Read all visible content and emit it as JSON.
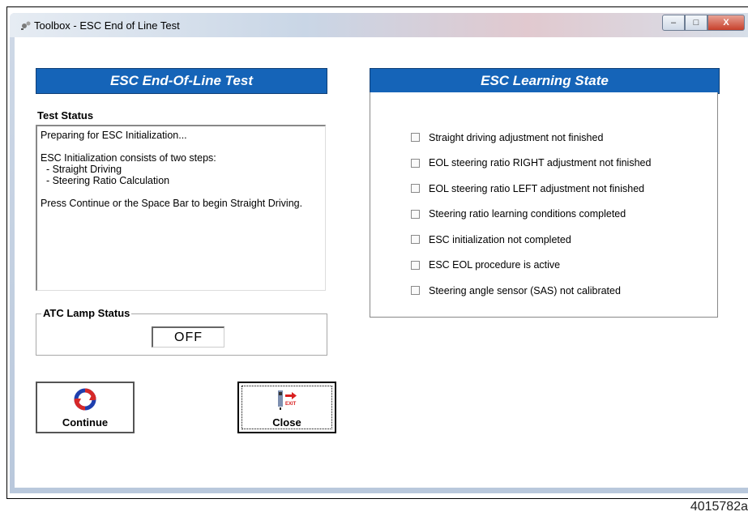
{
  "window": {
    "title": "Toolbox - ESC End of Line Test",
    "controls": {
      "minimize": "–",
      "maximize": "□",
      "close": "X"
    }
  },
  "figure_id": "4015782a",
  "left_panel": {
    "header": "ESC End-Of-Line Test",
    "test_status_label": "Test Status",
    "status_lines": [
      "Preparing for ESC Initialization...",
      "",
      "ESC Initialization consists of two steps:",
      "  - Straight Driving",
      "  - Steering Ratio Calculation",
      "",
      "Press Continue or the Space Bar to begin Straight Driving."
    ],
    "atc_lamp": {
      "label": "ATC Lamp Status",
      "value": "OFF"
    }
  },
  "right_panel": {
    "header": "ESC Learning State",
    "items": [
      {
        "label": "Straight driving adjustment not finished",
        "checked": false
      },
      {
        "label": "EOL steering ratio RIGHT adjustment not finished",
        "checked": false
      },
      {
        "label": "EOL steering ratio LEFT adjustment not finished",
        "checked": false
      },
      {
        "label": "Steering ratio learning conditions completed",
        "checked": false
      },
      {
        "label": "ESC initialization not completed",
        "checked": false
      },
      {
        "label": "ESC EOL procedure is active",
        "checked": false
      },
      {
        "label": "Steering angle sensor (SAS) not calibrated",
        "checked": false
      }
    ]
  },
  "buttons": {
    "continue": {
      "label": "Continue",
      "icon": "refresh-icon"
    },
    "close": {
      "label": "Close",
      "icon": "exit-icon",
      "icon_text": "EXIT"
    }
  },
  "colors": {
    "header_blue": "#1564b8",
    "exit_red": "#d92020"
  }
}
